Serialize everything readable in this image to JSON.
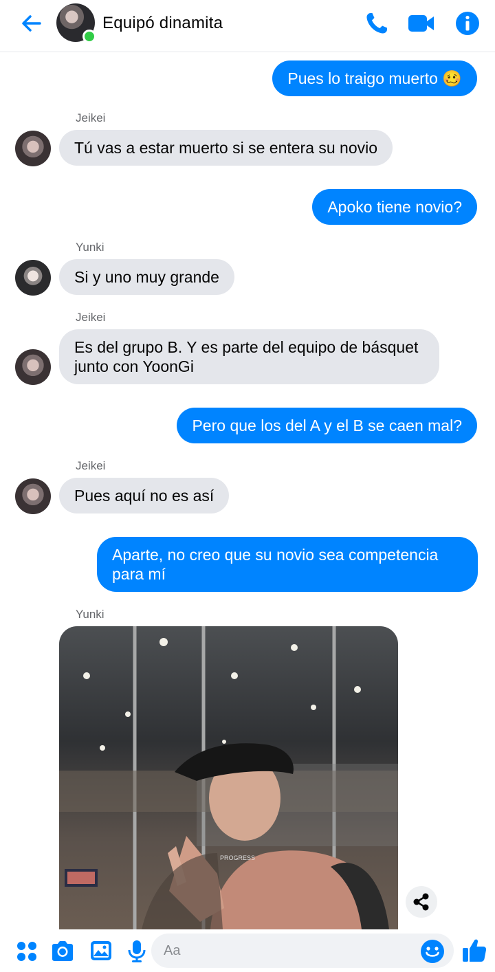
{
  "header": {
    "title": "Equipó dinamita",
    "icons": [
      "back-arrow-icon",
      "phone-icon",
      "video-camera-icon",
      "info-icon"
    ],
    "accent_color": "#0084ff",
    "online_color": "#31cc46"
  },
  "messages": [
    {
      "side": "out",
      "text": "Pues lo traigo muerto 🥴"
    },
    {
      "side": "in",
      "sender": "Jeikei",
      "text": "Tú vas a estar muerto si se entera su novio"
    },
    {
      "side": "out",
      "text": "Apoko tiene novio?"
    },
    {
      "side": "in",
      "sender": "Yunki",
      "text": "Si y uno muy grande"
    },
    {
      "side": "in",
      "sender": "Jeikei",
      "text": "Es del grupo B. Y es parte del equipo de básquet junto con YoonGi"
    },
    {
      "side": "out",
      "text": "Pero que los del A y el B se caen mal?"
    },
    {
      "side": "in",
      "sender": "Jeikei",
      "text": "Pues aquí no es así"
    },
    {
      "side": "out",
      "text": "Aparte, no creo que su novio sea competencia para mí"
    },
    {
      "side": "in",
      "sender": "Yunki",
      "type": "photo",
      "photo_text": "PROGRESS"
    }
  ],
  "composer": {
    "placeholder": "Aa",
    "value": "",
    "icons": [
      "apps-grid-icon",
      "camera-icon",
      "gallery-icon",
      "microphone-icon",
      "emoji-icon",
      "thumbs-up-icon"
    ]
  },
  "colors": {
    "outgoing_bubble": "#0084ff",
    "incoming_bubble": "#e4e6eb",
    "sender_label": "#65676b"
  }
}
